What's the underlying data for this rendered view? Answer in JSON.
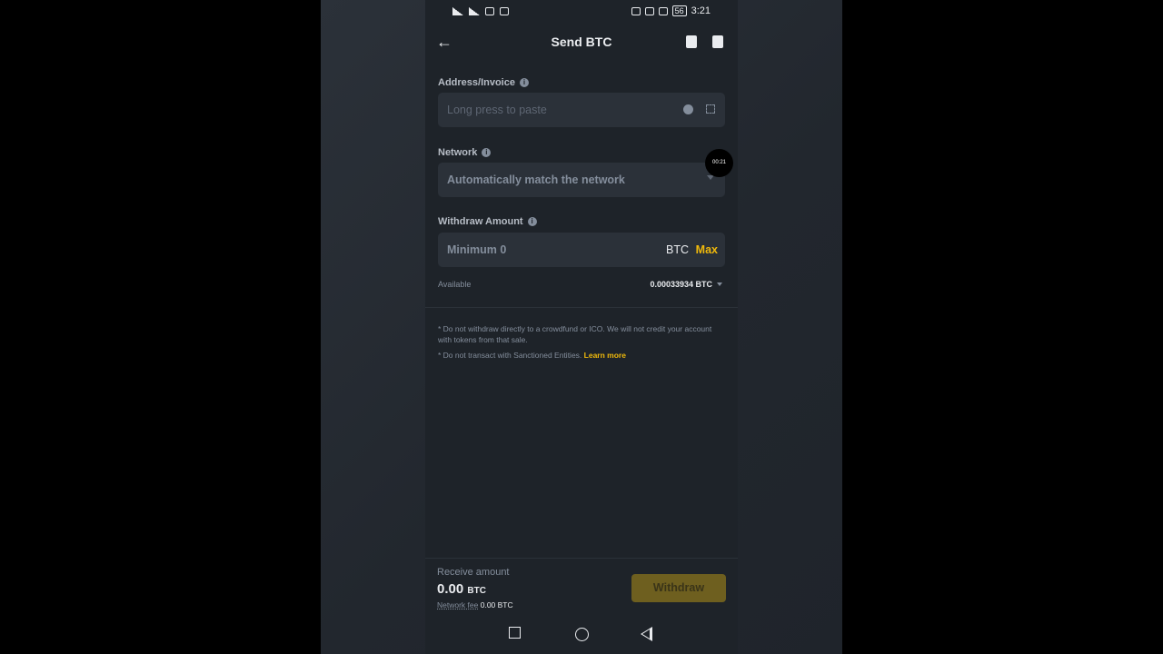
{
  "status_bar": {
    "time": "3:21",
    "battery": "56"
  },
  "header": {
    "title": "Send BTC",
    "back_icon": "arrow-left-icon",
    "icons": [
      "contacts-icon",
      "history-icon"
    ]
  },
  "address": {
    "label": "Address/Invoice",
    "placeholder": "Long press to paste"
  },
  "network": {
    "label": "Network",
    "placeholder": "Automatically match the network"
  },
  "timer_badge": "00:21",
  "amount": {
    "label": "Withdraw Amount",
    "placeholder": "Minimum 0",
    "unit": "BTC",
    "max_label": "Max"
  },
  "available": {
    "label": "Available",
    "value": "0.00033934 BTC"
  },
  "notes": {
    "note1": "* Do not withdraw directly to a crowdfund or ICO. We will not credit your account with tokens from that sale.",
    "note2": "* Do not transact with Sanctioned Entities.",
    "learn_more": "Learn more"
  },
  "footer": {
    "receive_label": "Receive amount",
    "receive_value": "0.00",
    "receive_unit": "BTC",
    "fee_label": "Network fee",
    "fee_value": "0.00 BTC",
    "withdraw_label": "Withdraw"
  },
  "colors": {
    "accent": "#f0b90b",
    "background": "#1e2329",
    "field": "#2b3139"
  }
}
